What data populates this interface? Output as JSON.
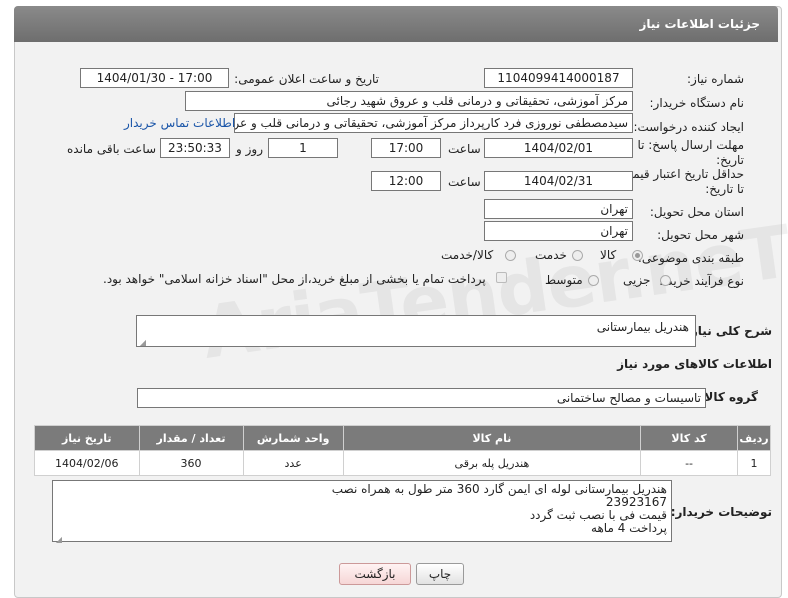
{
  "header": {
    "title": "جزئیات اطلاعات نیاز"
  },
  "fields": {
    "need_number_label": "شماره نیاز:",
    "need_number": "1104099414000187",
    "announce_label": "تاریخ و ساعت اعلان عمومی:",
    "announce_value": "1404/01/30 - 17:00",
    "buyer_label": "نام دستگاه خریدار:",
    "buyer_value": "مرکز آموزشی، تحقیقاتی و درمانی قلب و عروق شهید رجائی",
    "creator_label": "ایجاد کننده درخواست:",
    "creator_value": "سیدمصطفی نوروزی فرد کارپرداز مرکز آموزشی، تحقیقاتی و درمانی قلب و عروق",
    "contact_link": "اطلاعات تماس خریدار",
    "deadline_label_1": "مهلت ارسال پاسخ: تا",
    "deadline_label_2": "تاریخ:",
    "deadline_date": "1404/02/01",
    "time_label": "ساعت",
    "deadline_time": "17:00",
    "days_value": "1",
    "days_label": "روز و",
    "remaining_value": "23:50:33",
    "remaining_label": "ساعت باقی مانده",
    "min_price_label_1": "حداقل تاریخ اعتبار قیمت:",
    "min_price_label_2": "تا تاریخ:",
    "min_price_date": "1404/02/31",
    "min_price_time": "12:00",
    "province_label": "استان محل تحویل:",
    "province_value": "تهران",
    "city_label": "شهر محل تحویل:",
    "city_value": "تهران",
    "category_label": "طبقه بندی موضوعی:",
    "category_options": [
      "کالا",
      "خدمت",
      "کالا/خدمت"
    ],
    "process_label": "نوع فرآیند خرید :",
    "process_options": [
      "جزیی",
      "متوسط"
    ],
    "payment_note": "پرداخت تمام یا بخشی از مبلغ خرید،از محل \"اسناد خزانه اسلامی\" خواهد بود."
  },
  "description": {
    "label": "شرح کلی نیاز:",
    "value": "هندریل بیمارستانی"
  },
  "goods": {
    "section_title": "اطلاعات کالاهای مورد نیاز",
    "group_label": "گروه کالا:",
    "group_value": "تاسیسات و مصالح ساختمانی"
  },
  "table": {
    "headers": [
      "ردیف",
      "کد کالا",
      "نام کالا",
      "واحد شمارش",
      "تعداد / مقدار",
      "تاریخ نیاز"
    ],
    "rows": [
      [
        "1",
        "--",
        "هندریل پله برقی",
        "عدد",
        "360",
        "1404/02/06"
      ]
    ]
  },
  "buyer_notes": {
    "label": "توضیحات خریدار:",
    "lines": [
      "هندریل بیمارستانی لوله ای ایمن گارد 360 متر طول به همراه نصب",
      "23923167",
      "قیمت فی با نصب ثبت گردد",
      "پرداخت 4 ماهه"
    ]
  },
  "buttons": {
    "print": "چاپ",
    "back": "بازگشت"
  },
  "watermark": "AriaTender.neT"
}
